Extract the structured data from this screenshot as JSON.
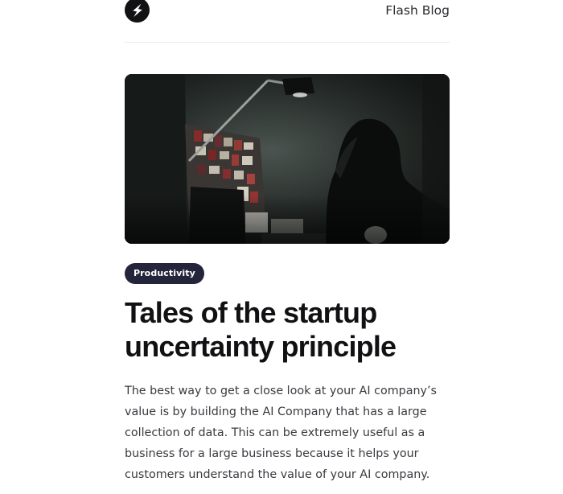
{
  "header": {
    "logo_icon": "lightning-bolt-icon",
    "site_name": "Flash Blog"
  },
  "post": {
    "image_alt": "Person working at a desk in a dark room under a desk lamp",
    "category": "Productivity",
    "title": "Tales of the startup uncertainty principle",
    "excerpt": "The best way to get a close look at your AI company’s value is by building the AI Company that has a large collection of data. This can be extremely useful as a business for a large business because it helps your customers understand the value of your AI company."
  },
  "colors": {
    "logo_bg": "#121214",
    "tag_bg": "#24243a",
    "title": "#111113",
    "body_text": "#3a3a40"
  }
}
